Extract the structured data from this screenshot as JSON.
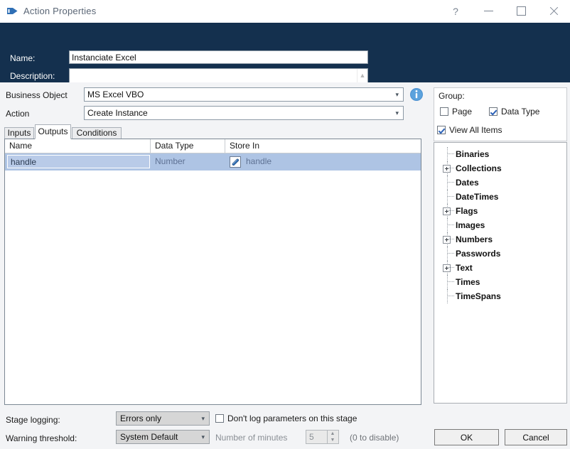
{
  "window": {
    "title": "Action Properties",
    "icon": "blueprism-action-icon",
    "controls": {
      "help": "?",
      "minimize": "minimize-icon",
      "maximize": "maximize-icon",
      "close": "close-icon"
    }
  },
  "header": {
    "name_label": "Name:",
    "name_value": "Instanciate Excel",
    "description_label": "Description:",
    "description_value": "",
    "description_placeholder": ""
  },
  "form": {
    "business_object_label": "Business Object",
    "business_object_value": "MS Excel VBO",
    "action_label": "Action",
    "action_value": "Create Instance",
    "dropdown_caret": "⌄",
    "info_icon": "info-icon"
  },
  "tabs": [
    {
      "label": "Inputs",
      "active": false
    },
    {
      "label": "Outputs",
      "active": true
    },
    {
      "label": "Conditions",
      "active": false
    }
  ],
  "grid": {
    "columns": [
      "Name",
      "Data Type",
      "Store In"
    ],
    "rows": [
      {
        "name": "handle",
        "data_type": "Number",
        "store_in": "handle",
        "store_in_icon": "data-item-icon",
        "selected": true
      }
    ]
  },
  "group_panel": {
    "title": "Group:",
    "checkboxes": [
      {
        "label": "Page",
        "checked": false
      },
      {
        "label": "Data Type",
        "checked": true
      },
      {
        "label": "View All Items",
        "checked": true
      }
    ]
  },
  "tree": {
    "items": [
      {
        "label": "Binaries",
        "expandable": false
      },
      {
        "label": "Collections",
        "expandable": true
      },
      {
        "label": "Dates",
        "expandable": false
      },
      {
        "label": "DateTimes",
        "expandable": false
      },
      {
        "label": "Flags",
        "expandable": true
      },
      {
        "label": "Images",
        "expandable": false
      },
      {
        "label": "Numbers",
        "expandable": true
      },
      {
        "label": "Passwords",
        "expandable": false
      },
      {
        "label": "Text",
        "expandable": true
      },
      {
        "label": "Times",
        "expandable": false
      },
      {
        "label": "TimeSpans",
        "expandable": false
      }
    ]
  },
  "footer": {
    "stage_logging_label": "Stage logging:",
    "stage_logging_value": "Errors only",
    "warning_threshold_label": "Warning threshold:",
    "warning_threshold_value": "System Default",
    "dont_log_label": "Don't log parameters on this stage",
    "dont_log_checked": false,
    "number_of_minutes_label": "Number of minutes",
    "number_of_minutes_value": "5",
    "disable_hint": "(0 to disable)",
    "ok_label": "OK",
    "cancel_label": "Cancel",
    "dropdown_caret": "⌄"
  },
  "colors": {
    "navy": "#14304e",
    "accent_blue": "#2e63b8",
    "selection": "#aec4e4",
    "body": "#f3f4f6"
  }
}
